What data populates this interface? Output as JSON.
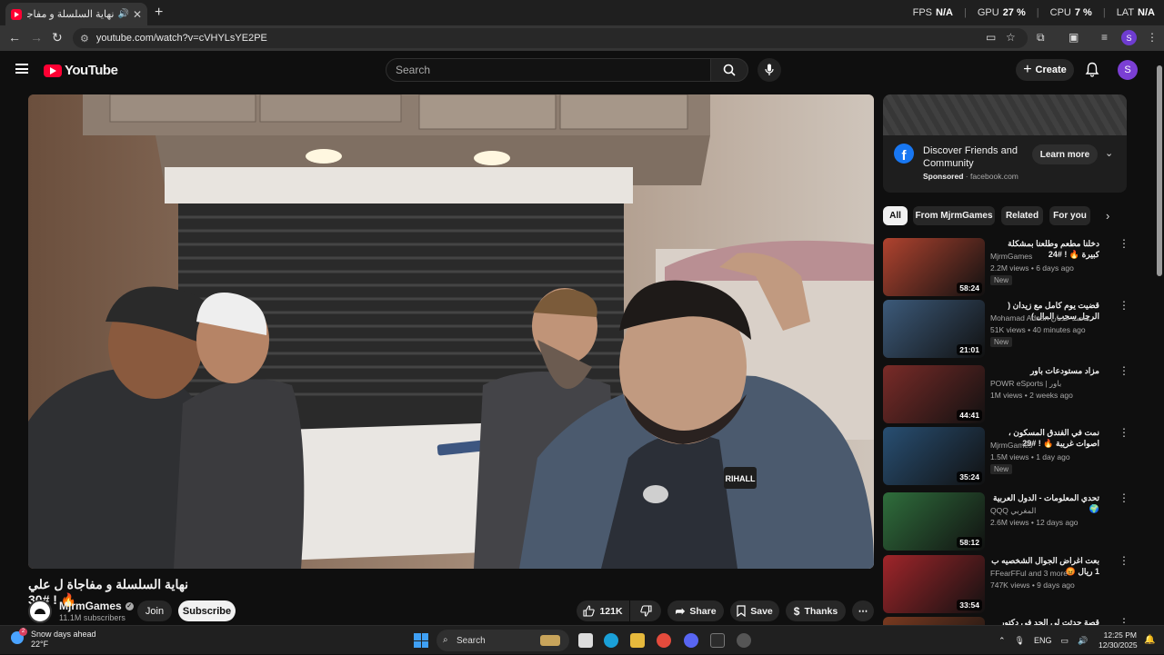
{
  "browser": {
    "tab_title": "نهاية السلسلة و مفاجاة ل علي",
    "url": "youtube.com/watch?v=cVHYLsYE2PE",
    "perf": {
      "fps_label": "FPS",
      "fps_value": "N/A",
      "gpu_label": "GPU",
      "gpu_value": "27 %",
      "cpu_label": "CPU",
      "cpu_value": "7 %",
      "lat_label": "LAT",
      "lat_value": "N/A"
    },
    "profile_initial": "S"
  },
  "masthead": {
    "logo_text": "YouTube",
    "search_placeholder": "Search",
    "create_label": "Create",
    "avatar_initial": "S"
  },
  "video": {
    "title": "نهاية السلسلة و مفاجاة ل علي 🔥 ! #30",
    "channel_name": "MjrmGames",
    "subscribers": "11.1M subscribers",
    "join_label": "Join",
    "subscribe_label": "Subscribe",
    "likes": "121K",
    "share_label": "Share",
    "save_label": "Save",
    "thanks_label": "Thanks",
    "patch_text": "RIHALL"
  },
  "ad": {
    "title": "Discover Friends and Community",
    "sponsored": "Sponsored",
    "domain": "facebook.com",
    "cta": "Learn more"
  },
  "chips": [
    "All",
    "From MjrmGames",
    "Related",
    "For you"
  ],
  "recommendations": [
    {
      "title": "دخلنا مطعم وطلعنا بمشكلة كبيرة 🔥 ! #24",
      "channel": "MjrmGames",
      "meta": "2.2M views • 6 days ago",
      "badge": "New",
      "duration": "58:24",
      "thumb_color": "#b0432f"
    },
    {
      "title": "قضيت يوم كامل مع زيدان ( الرجل سحب المال )",
      "channel": "Mohamad Adnan محمد عدنان",
      "meta": "51K views • 40 minutes ago",
      "badge": "New",
      "duration": "21:01",
      "thumb_color": "#3c5a7a"
    },
    {
      "title": "مزاد مستودعات باور",
      "channel": "POWR eSports | باور",
      "meta": "1M views • 2 weeks ago",
      "badge": "",
      "duration": "44:41",
      "thumb_color": "#7a2b28"
    },
    {
      "title": "نمت في الفندق المسكون ، اصوات غريبة 🔥 ! #29",
      "channel": "MjrmGames",
      "meta": "1.5M views • 1 day ago",
      "badge": "New",
      "duration": "35:24",
      "thumb_color": "#284f73"
    },
    {
      "title": "تحدي المعلومات - الدول العربية 🌍",
      "channel": "QQQ المغربي",
      "meta": "2.6M views • 12 days ago",
      "badge": "",
      "duration": "58:12",
      "thumb_color": "#2f6e3c"
    },
    {
      "title": "بعت اغراض الجوال الشخصيه ب 1 ريال 😡",
      "channel": "FFearFFul and 3 more",
      "meta": "747K views • 9 days ago",
      "badge": "",
      "duration": "33:54",
      "thumb_color": "#a0252a"
    },
    {
      "title": "قصة حدثت لي الحد في دكتور امتحان عالي !",
      "channel": "",
      "meta": "",
      "badge": "",
      "duration": "",
      "thumb_color": "#7a3a20"
    }
  ],
  "taskbar": {
    "weather_title": "Snow days ahead",
    "weather_temp": "22°F",
    "weather_badge": "2",
    "search_label": "Search",
    "lang": "ENG",
    "time": "12:25 PM",
    "date": "12/30/2025"
  }
}
